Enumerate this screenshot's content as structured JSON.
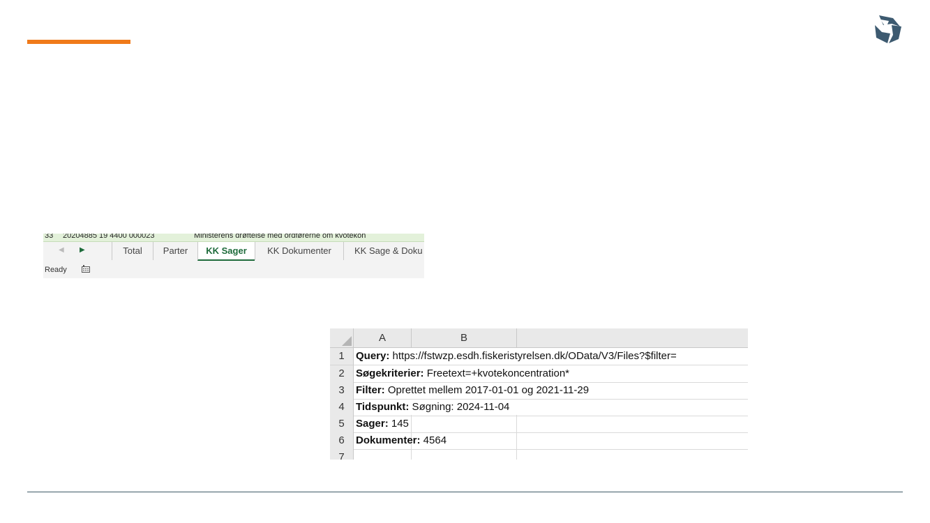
{
  "tabstrip": {
    "row_number": "33",
    "row_id": "20204885 19 4400 000023",
    "row_text": "Ministerens drøftelse med ordførerne om kvotekon",
    "tabs": [
      "Total",
      "Parter",
      "KK Sager",
      "KK Dokumenter",
      "KK Sage & Doku"
    ],
    "active_tab": "KK Sager",
    "status": "Ready",
    "accent_color": "#1e6b3b"
  },
  "sheet": {
    "columns": [
      "A",
      "B"
    ],
    "rows": [
      {
        "num": "1",
        "label": "Query:",
        "value": " https://fstwzp.esdh.fiskeristyrelsen.dk/OData/V3/Files?$filter="
      },
      {
        "num": "2",
        "label": "Søgekriterier:",
        "value": " Freetext=+kvotekoncentration*"
      },
      {
        "num": "3",
        "label": "Filter:",
        "value": " Oprettet mellem 2017-01-01 og 2021-11-29"
      },
      {
        "num": "4",
        "label": "Tidspunkt:",
        "value": " Søgning: 2024-11-04"
      },
      {
        "num": "5",
        "label": "Sager:",
        "value": " 145"
      },
      {
        "num": "6",
        "label": "Dokumenter:",
        "value": " 4564"
      },
      {
        "num": "7",
        "label": "",
        "value": ""
      }
    ]
  },
  "colors": {
    "accent_orange": "#f07a1a",
    "logo": "#3d5a70"
  }
}
